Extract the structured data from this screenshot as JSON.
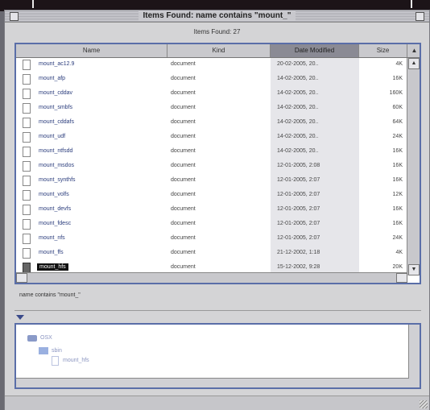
{
  "window": {
    "title": "Items Found: name contains \"mount_\"",
    "count_label": "Items Found: 27"
  },
  "columns": {
    "name": "Name",
    "kind": "Kind",
    "date": "Date Modified",
    "size": "Size"
  },
  "rows": [
    {
      "name": "mount_ac12.9",
      "kind": "document",
      "date": "20-02-2005, 20..",
      "size": "4K"
    },
    {
      "name": "mount_afp",
      "kind": "document",
      "date": "14-02-2005, 20..",
      "size": "16K"
    },
    {
      "name": "mount_cddav",
      "kind": "document",
      "date": "14-02-2005, 20..",
      "size": "160K"
    },
    {
      "name": "mount_smbfs",
      "kind": "document",
      "date": "14-02-2005, 20..",
      "size": "60K"
    },
    {
      "name": "mount_cddafs",
      "kind": "document",
      "date": "14-02-2005, 20..",
      "size": "64K"
    },
    {
      "name": "mount_udf",
      "kind": "document",
      "date": "14-02-2005, 20..",
      "size": "24K"
    },
    {
      "name": "mount_ntfsdd",
      "kind": "document",
      "date": "14-02-2005, 20..",
      "size": "16K"
    },
    {
      "name": "mount_msdos",
      "kind": "document",
      "date": "12-01-2005, 2:08",
      "size": "16K"
    },
    {
      "name": "mount_synthfs",
      "kind": "document",
      "date": "12-01-2005, 2:07",
      "size": "16K"
    },
    {
      "name": "mount_volfs",
      "kind": "document",
      "date": "12-01-2005, 2:07",
      "size": "12K"
    },
    {
      "name": "mount_devfs",
      "kind": "document",
      "date": "12-01-2005, 2:07",
      "size": "16K"
    },
    {
      "name": "mount_fdesc",
      "kind": "document",
      "date": "12-01-2005, 2:07",
      "size": "16K"
    },
    {
      "name": "mount_nfs",
      "kind": "document",
      "date": "12-01-2005, 2:07",
      "size": "24K"
    },
    {
      "name": "mount_ffs",
      "kind": "document",
      "date": "21-12-2002, 1:18",
      "size": "4K"
    },
    {
      "name": "mount_hfs",
      "kind": "document",
      "date": "15-12-2002, 9:28",
      "size": "20K",
      "selected": true
    }
  ],
  "criteria": "name contains \"mount_\"",
  "path": {
    "disk": "OSX",
    "folder": "sbin",
    "file": "mount_hfs"
  },
  "icons": {
    "close": "close-box-icon",
    "zoom": "zoom-box-icon",
    "document": "document-icon",
    "disk": "hard-disk-icon",
    "folder": "folder-icon",
    "disclosure": "disclosure-triangle-icon"
  },
  "colors": {
    "selection": "#111111",
    "filename": "#2a3c7c",
    "accent_border": "#5a6ea8"
  }
}
